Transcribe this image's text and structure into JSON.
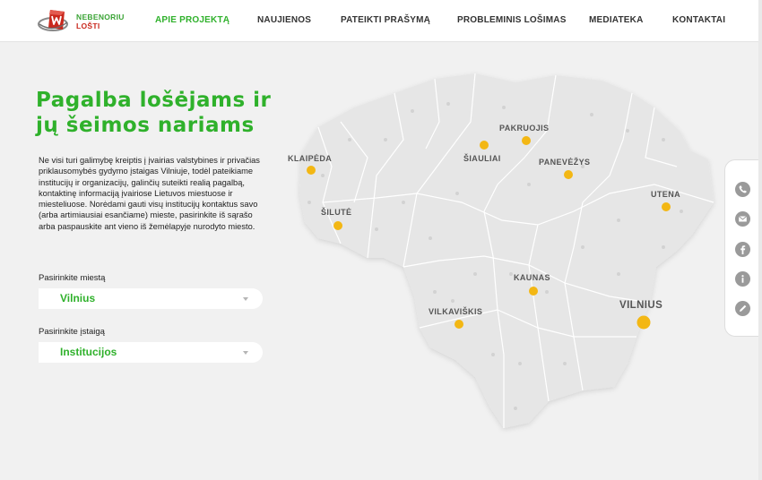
{
  "brand": {
    "line1": "NEBENORIU",
    "line2": "LOŠTI",
    "colors": {
      "green": "#2fb12b",
      "red": "#c9281d"
    }
  },
  "nav": {
    "items": [
      {
        "label": "APIE PROJEKTĄ",
        "active": true
      },
      {
        "label": "NAUJIENOS"
      },
      {
        "label": "PATEIKTI PRAŠYMĄ"
      },
      {
        "label": "PROBLEMINIS LOŠIMAS"
      },
      {
        "label": "MEDIATEKA"
      },
      {
        "label": "KONTAKTAI"
      }
    ]
  },
  "hero": {
    "title": "Pagalba lošėjams ir jų šeimos nariams",
    "intro": "Ne visi turi galimybę kreiptis į įvairias valstybines ir privačias priklausomybės gydymo įstaigas Vilniuje, todėl pateikiame institucijų ir organizacijų, galinčių suteikti realią pagalbą, kontaktinę informaciją įvairiose Lietuvos miestuose ir miesteliuose. Norėdami gauti visų institucijų kontaktus savo (arba artimiausiai esančiame) mieste, pasirinkite iš sąrašo arba paspauskite ant vieno iš žemėlapyje nurodyto miesto."
  },
  "filters": {
    "city": {
      "label": "Pasirinkite miestą",
      "value": "Vilnius"
    },
    "institution": {
      "label": "Pasirinkite įstaigą",
      "value": "Institucijos"
    }
  },
  "map": {
    "cities": [
      {
        "name": "PAKRUOJIS"
      },
      {
        "name": "ŠIAULIAI"
      },
      {
        "name": "KLAIPĖDA"
      },
      {
        "name": "PANEVĖŽYS"
      },
      {
        "name": "UTENA"
      },
      {
        "name": "ŠILUTĖ"
      },
      {
        "name": "KAUNAS"
      },
      {
        "name": "VILNIUS",
        "selected": true
      },
      {
        "name": "VILKAVIŠKIS"
      }
    ],
    "marker_color": "#f3b714"
  },
  "social": {
    "icons": [
      "phone-icon",
      "email-icon",
      "facebook-icon",
      "info-icon",
      "edit-icon"
    ]
  }
}
